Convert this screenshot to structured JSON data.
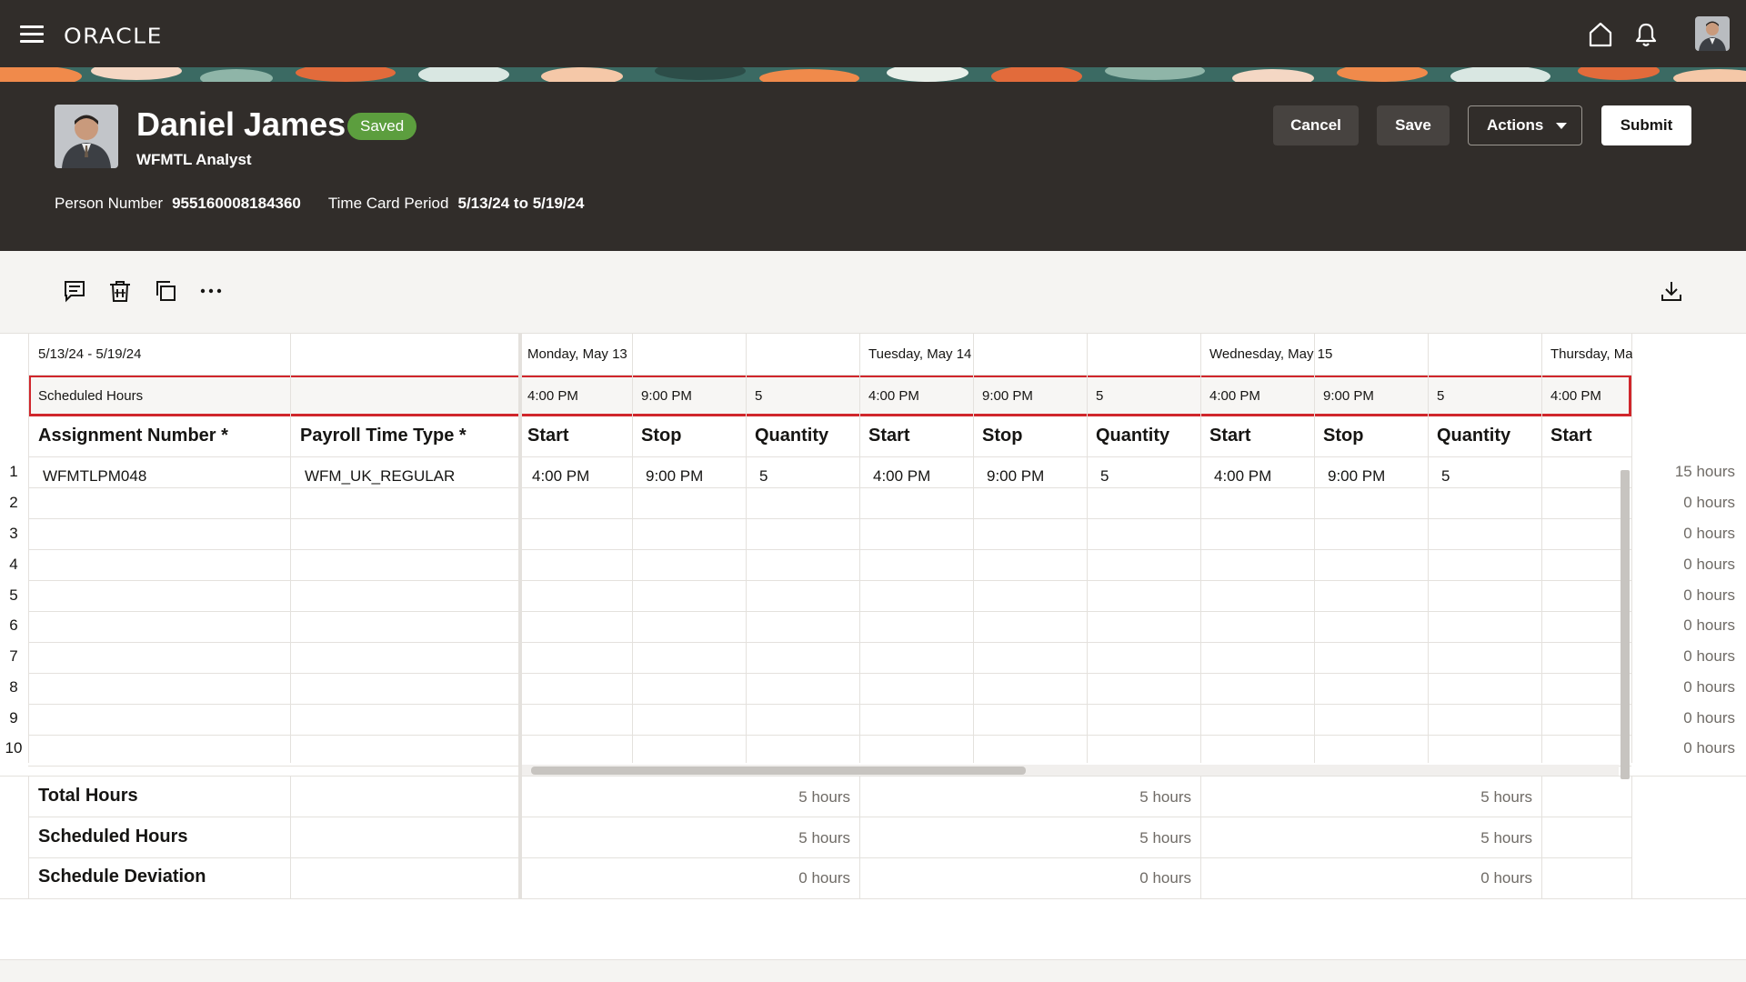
{
  "app": {
    "brand": "ORACLE"
  },
  "header": {
    "name": "Daniel James",
    "status": "Saved",
    "title": "WFMTL Analyst",
    "person_number_label": "Person Number",
    "person_number": "955160008184360",
    "period_label": "Time Card Period",
    "period": "5/13/24 to 5/19/24",
    "buttons": {
      "cancel": "Cancel",
      "save": "Save",
      "actions": "Actions",
      "submit": "Submit"
    }
  },
  "colors": {
    "dark_bg": "#312d2a",
    "saved_badge": "#5c9e3e",
    "highlight_border": "#d0262c"
  },
  "grid": {
    "date_range": "5/13/24 - 5/19/24",
    "days": [
      "Monday, May 13",
      "Tuesday, May 14",
      "Wednesday, May 15",
      "Thursday, Ma"
    ],
    "scheduled_label": "Scheduled Hours",
    "scheduled": [
      {
        "start": "4:00 PM",
        "stop": "9:00 PM",
        "qty": "5"
      },
      {
        "start": "4:00 PM",
        "stop": "9:00 PM",
        "qty": "5"
      },
      {
        "start": "4:00 PM",
        "stop": "9:00 PM",
        "qty": "5"
      },
      {
        "start": "4:00 PM"
      }
    ],
    "columns": {
      "assignment": "Assignment Number *",
      "payroll": "Payroll Time Type *",
      "start": "Start",
      "stop": "Stop",
      "quantity": "Quantity"
    },
    "rows": [
      {
        "num": "1",
        "assignment": "WFMTLPM048",
        "payroll": "WFM_UK_REGULAR",
        "entries": [
          {
            "start": "4:00 PM",
            "stop": "9:00 PM",
            "qty": "5"
          },
          {
            "start": "4:00 PM",
            "stop": "9:00 PM",
            "qty": "5"
          },
          {
            "start": "4:00 PM",
            "stop": "9:00 PM",
            "qty": "5"
          }
        ],
        "total": "15 hours"
      },
      {
        "num": "2",
        "total": "0 hours"
      },
      {
        "num": "3",
        "total": "0 hours"
      },
      {
        "num": "4",
        "total": "0 hours"
      },
      {
        "num": "5",
        "total": "0 hours"
      },
      {
        "num": "6",
        "total": "0 hours"
      },
      {
        "num": "7",
        "total": "0 hours"
      },
      {
        "num": "8",
        "total": "0 hours"
      },
      {
        "num": "9",
        "total": "0 hours"
      },
      {
        "num": "10",
        "total": "0 hours"
      }
    ],
    "summary": [
      {
        "label": "Total Hours",
        "values": [
          "5 hours",
          "5 hours",
          "5 hours"
        ]
      },
      {
        "label": "Scheduled Hours",
        "values": [
          "5 hours",
          "5 hours",
          "5 hours"
        ]
      },
      {
        "label": "Schedule Deviation",
        "values": [
          "0 hours",
          "0 hours",
          "0 hours"
        ]
      }
    ]
  }
}
